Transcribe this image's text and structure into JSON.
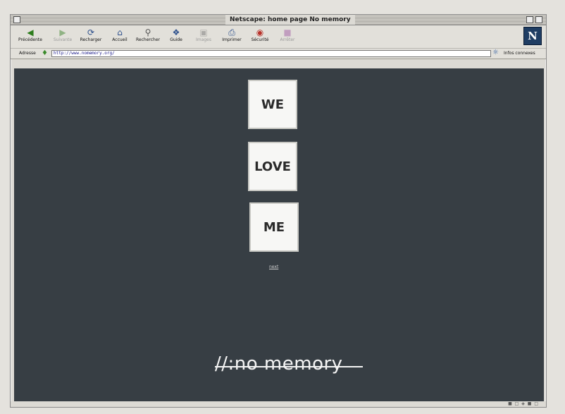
{
  "window": {
    "title": "Netscape: home page No memory"
  },
  "toolbar": {
    "buttons": [
      {
        "label": "Précédente",
        "icon": "back-arrow-icon",
        "enabled": true
      },
      {
        "label": "Suivante",
        "icon": "forward-arrow-icon",
        "enabled": false
      },
      {
        "label": "Recharger",
        "icon": "reload-icon",
        "enabled": true
      },
      {
        "label": "Accueil",
        "icon": "home-icon",
        "enabled": true
      },
      {
        "label": "Rechercher",
        "icon": "search-icon",
        "enabled": true
      },
      {
        "label": "Guide",
        "icon": "guide-icon",
        "enabled": true
      },
      {
        "label": "Images",
        "icon": "images-icon",
        "enabled": false
      },
      {
        "label": "Imprimer",
        "icon": "print-icon",
        "enabled": true
      },
      {
        "label": "Sécurité",
        "icon": "security-icon",
        "enabled": true
      },
      {
        "label": "Arrêter",
        "icon": "stop-icon",
        "enabled": false
      }
    ],
    "logo": "N"
  },
  "location": {
    "label": "Adresse",
    "url": "http://www.nomemory.org/",
    "related_label": "Infos connexes"
  },
  "page": {
    "words": [
      "WE",
      "LOVE",
      "ME"
    ],
    "next_link": "next",
    "brand": "//:no memory"
  },
  "colors": {
    "page_background": "#373e44",
    "box_background": "#f7f7f5",
    "brand_text": "#f4f4f4"
  }
}
